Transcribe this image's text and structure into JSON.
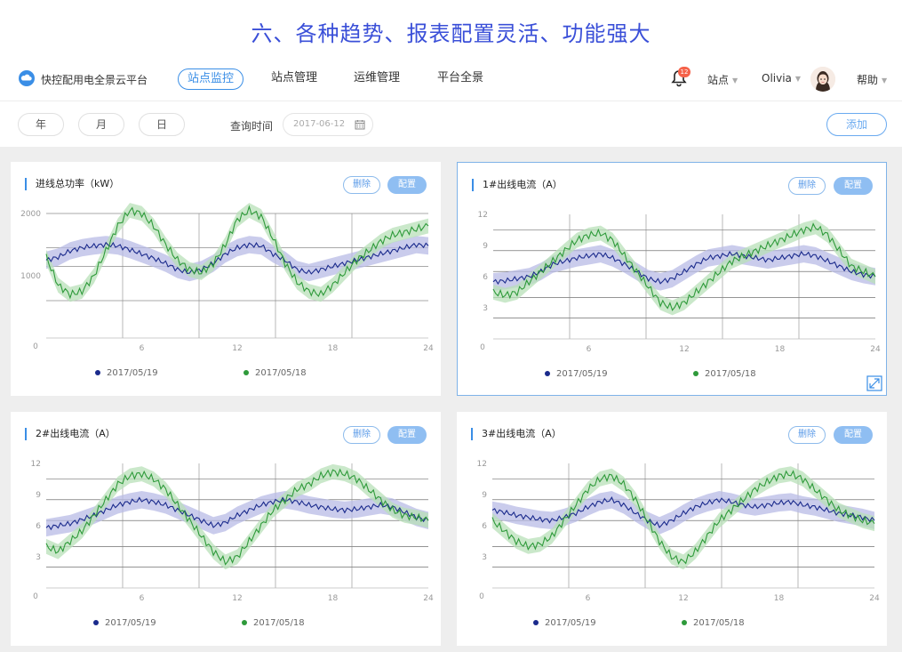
{
  "headline": "六、各种趋势、报表配置灵活、功能强大",
  "topnav": {
    "brand": "快控配用电全景云平台",
    "items": [
      {
        "label": "站点监控",
        "active": true
      },
      {
        "label": "站点管理",
        "active": false
      },
      {
        "label": "运维管理",
        "active": false
      },
      {
        "label": "平台全景",
        "active": false
      }
    ],
    "notification_count": "12",
    "site_label": "站点",
    "user_name": "Olivia",
    "help_label": "帮助"
  },
  "filter": {
    "year": "年",
    "month": "月",
    "day": "日",
    "query_label": "查询时间",
    "date_value": "2017-06-12",
    "add_label": "添加"
  },
  "colors": {
    "accent": "#3a8ee6",
    "series_1": "#1a2a8c",
    "series_1_band": "#b8bbe6",
    "series_2": "#2e9a3a",
    "series_2_band": "#b8e0b8"
  },
  "panels": [
    {
      "title": "进线总功率（kW）",
      "delete_label": "删除",
      "config_label": "配置",
      "chart_data": {
        "type": "line",
        "x_ticks": [
          "6",
          "12",
          "18",
          "24"
        ],
        "x_origin": "0",
        "y_ticks": [
          "1000",
          "2000"
        ],
        "ylim": [
          0,
          2000
        ],
        "series": [
          {
            "name": "2017/05/19",
            "values": [
              1250,
              1300,
              1400,
              1450,
              1480,
              1500,
              1480,
              1420,
              1350,
              1280,
              1200,
              1100,
              1050,
              1100,
              1200,
              1350,
              1450,
              1500,
              1480,
              1350,
              1250,
              1100,
              1050,
              1100,
              1150,
              1200,
              1250,
              1300,
              1350,
              1400,
              1450,
              1500,
              1480
            ]
          },
          {
            "name": "2017/05/18",
            "values": [
              1300,
              850,
              700,
              750,
              1000,
              1400,
              1800,
              2050,
              2000,
              1800,
              1500,
              1250,
              1100,
              1050,
              1200,
              1500,
              1900,
              2050,
              1950,
              1600,
              1200,
              900,
              750,
              700,
              850,
              1050,
              1250,
              1400,
              1550,
              1650,
              1700,
              1750,
              1800
            ]
          }
        ]
      },
      "legend": [
        "2017/05/19",
        "2017/05/18"
      ]
    },
    {
      "title": "1#出线电流（A）",
      "delete_label": "删除",
      "config_label": "配置",
      "chart_data": {
        "type": "line",
        "x_ticks": [
          "6",
          "12",
          "18",
          "24"
        ],
        "x_origin": "0",
        "y_ticks": [
          "3",
          "6",
          "9",
          "12"
        ],
        "ylim": [
          0,
          12
        ],
        "series": [
          {
            "name": "2017/05/19",
            "values": [
              5.5,
              5.6,
              5.8,
              6.0,
              6.5,
              7.2,
              7.5,
              7.8,
              8.0,
              8.2,
              7.8,
              7.2,
              6.5,
              5.8,
              5.5,
              5.8,
              6.5,
              7.2,
              7.8,
              8.0,
              8.2,
              8.0,
              7.8,
              7.6,
              7.8,
              8.0,
              8.2,
              8.0,
              7.5,
              7.0,
              6.5,
              6.2,
              6.0
            ]
          },
          {
            "name": "2017/05/18",
            "values": [
              4.5,
              4.2,
              4.5,
              5.5,
              6.5,
              7.5,
              8.5,
              9.5,
              10.0,
              10.2,
              9.5,
              8.0,
              6.5,
              5.0,
              3.5,
              3.0,
              3.5,
              4.5,
              5.5,
              6.5,
              7.5,
              8.0,
              8.5,
              9.0,
              9.5,
              10.0,
              10.5,
              10.8,
              10.0,
              8.5,
              7.0,
              6.5,
              6.0
            ]
          }
        ]
      },
      "legend": [
        "2017/05/19",
        "2017/05/18"
      ]
    },
    {
      "title": "2#出线电流（A）",
      "delete_label": "删除",
      "config_label": "配置",
      "chart_data": {
        "type": "line",
        "x_ticks": [
          "6",
          "12",
          "18",
          "24"
        ],
        "x_origin": "0",
        "y_ticks": [
          "3",
          "6",
          "9",
          "12"
        ],
        "ylim": [
          0,
          12
        ],
        "series": [
          {
            "name": "2017/05/19",
            "values": [
              5.8,
              6.0,
              6.2,
              6.6,
              7.0,
              7.5,
              8.0,
              8.3,
              8.5,
              8.3,
              8.0,
              7.5,
              7.0,
              6.5,
              6.0,
              6.3,
              7.0,
              7.5,
              8.0,
              8.3,
              8.5,
              8.3,
              8.0,
              7.8,
              7.6,
              7.5,
              7.6,
              7.8,
              8.0,
              7.8,
              7.3,
              6.8,
              6.5
            ]
          },
          {
            "name": "2017/05/18",
            "values": [
              4.0,
              3.5,
              4.5,
              5.5,
              7.0,
              8.5,
              10.0,
              10.8,
              11.0,
              10.5,
              9.5,
              8.0,
              6.5,
              5.0,
              3.5,
              2.5,
              3.0,
              4.5,
              6.0,
              7.5,
              8.5,
              9.5,
              10.0,
              10.8,
              11.2,
              11.0,
              10.5,
              9.5,
              8.5,
              7.5,
              7.0,
              6.8,
              6.5
            ]
          }
        ]
      },
      "legend": [
        "2017/05/19",
        "2017/05/18"
      ]
    },
    {
      "title": "3#出线电流（A）",
      "delete_label": "删除",
      "config_label": "配置",
      "chart_data": {
        "type": "line",
        "x_ticks": [
          "6",
          "12",
          "18",
          "24"
        ],
        "x_origin": "0",
        "y_ticks": [
          "3",
          "6",
          "9",
          "12"
        ],
        "ylim": [
          0,
          12
        ],
        "series": [
          {
            "name": "2017/05/19",
            "values": [
              7.5,
              7.3,
              7.0,
              6.8,
              6.6,
              6.5,
              6.8,
              7.2,
              7.8,
              8.3,
              8.5,
              8.0,
              7.2,
              6.5,
              6.0,
              6.5,
              7.2,
              7.8,
              8.2,
              8.5,
              8.3,
              8.0,
              7.8,
              8.0,
              8.2,
              8.3,
              8.0,
              7.8,
              7.5,
              7.2,
              7.0,
              6.8,
              6.5
            ]
          },
          {
            "name": "2017/05/18",
            "values": [
              6.5,
              5.5,
              4.5,
              4.0,
              4.2,
              5.0,
              6.5,
              8.0,
              9.5,
              10.5,
              10.8,
              10.0,
              8.5,
              6.5,
              4.5,
              3.0,
              2.5,
              3.5,
              5.0,
              6.5,
              7.5,
              8.5,
              9.5,
              10.2,
              10.8,
              11.0,
              10.5,
              9.5,
              8.5,
              7.5,
              7.0,
              6.5,
              6.2
            ]
          }
        ]
      },
      "legend": [
        "2017/05/19",
        "2017/05/18"
      ]
    }
  ]
}
